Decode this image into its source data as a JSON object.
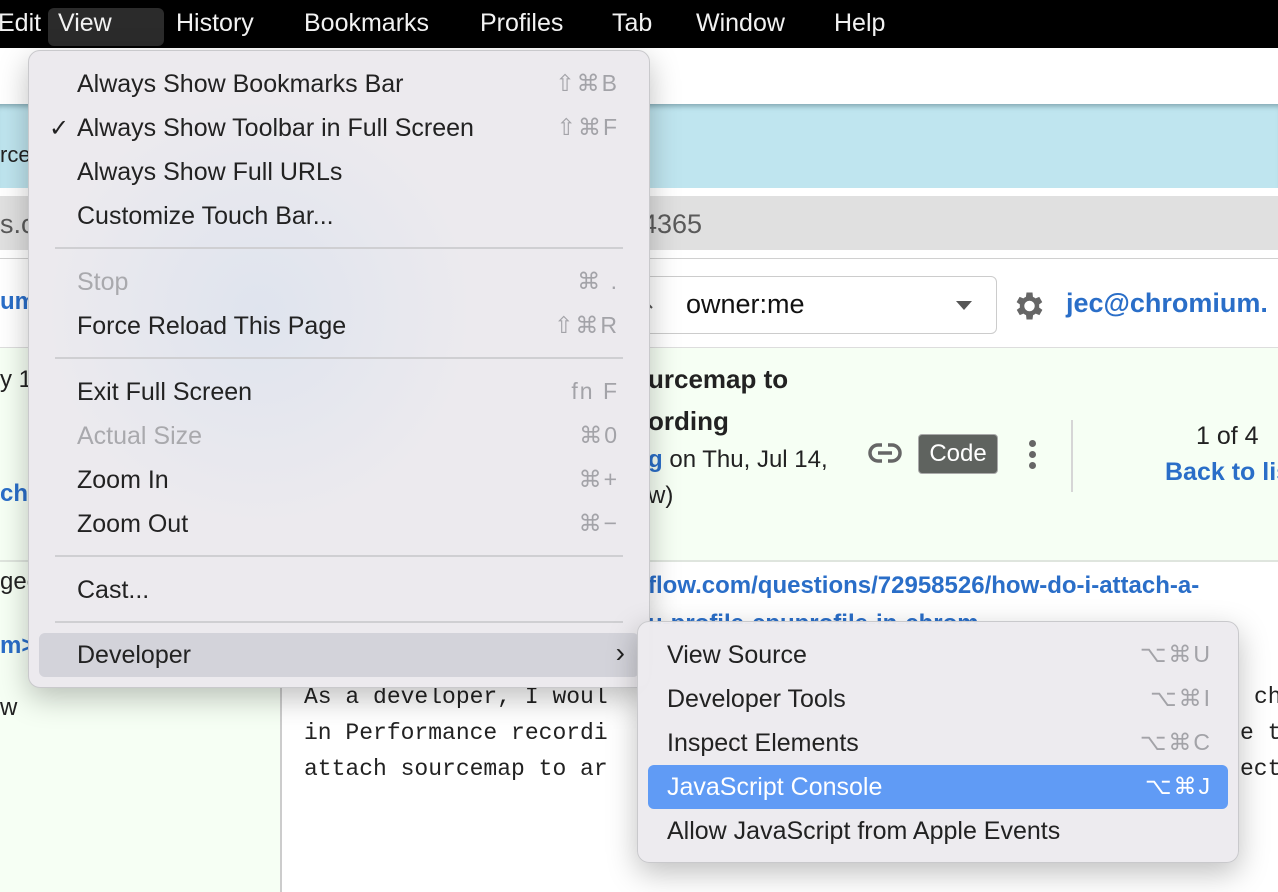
{
  "menubar": {
    "items": [
      "Edit",
      "View",
      "History",
      "Bookmarks",
      "Profiles",
      "Tab",
      "Window",
      "Help"
    ],
    "active": "View"
  },
  "page": {
    "blue_band_left_fragment": "rce",
    "address_left_fragment": "s.c",
    "address_right_fragment": "4365",
    "search_value": "owner:me",
    "user_email": "jec@chromium.",
    "left_fragments": {
      "um": "um",
      "y1": "y 1",
      "chr": "chr",
      "ged": "ged",
      "m": "m>",
      "w": "w"
    },
    "issue_title_line1": "urcemap to",
    "issue_title_line2": "ording",
    "meta_link_fragment": "g",
    "meta_text": " on Thu, Jul 14,",
    "meta_line2": "w)",
    "code_button": "Code",
    "pager": "1 of 4",
    "back_link": "Back to lis",
    "url_line1": "flow.com/questions/72958526/how-do-i-attach-a-",
    "url_line2": "u-profile-cpuprofile-in-chrom",
    "body_lines": [
      "As a developer, I woul",
      "in Performance recordi",
      "attach sourcemap to ar"
    ],
    "body_right_fragments": [
      "ch",
      "e t",
      "ect"
    ]
  },
  "view_menu": {
    "items": [
      {
        "label": "Always Show Bookmarks Bar",
        "shortcut": "⇧⌘B",
        "checked": false,
        "enabled": true
      },
      {
        "label": "Always Show Toolbar in Full Screen",
        "shortcut": "⇧⌘F",
        "checked": true,
        "enabled": true
      },
      {
        "label": "Always Show Full URLs",
        "shortcut": "",
        "checked": false,
        "enabled": true
      },
      {
        "label": "Customize Touch Bar...",
        "shortcut": "",
        "checked": false,
        "enabled": true
      },
      {
        "label": "Stop",
        "shortcut": "⌘ .",
        "checked": false,
        "enabled": false
      },
      {
        "label": "Force Reload This Page",
        "shortcut": "⇧⌘R",
        "checked": false,
        "enabled": true
      },
      {
        "label": "Exit Full Screen",
        "shortcut": "fn F",
        "checked": false,
        "enabled": true
      },
      {
        "label": "Actual Size",
        "shortcut": "⌘0",
        "checked": false,
        "enabled": false
      },
      {
        "label": "Zoom In",
        "shortcut": "⌘+",
        "checked": false,
        "enabled": true
      },
      {
        "label": "Zoom Out",
        "shortcut": "⌘−",
        "checked": false,
        "enabled": true
      },
      {
        "label": "Cast...",
        "shortcut": "",
        "checked": false,
        "enabled": true
      },
      {
        "label": "Developer",
        "shortcut": "",
        "checked": false,
        "enabled": true,
        "submenu": true
      }
    ],
    "check_glyph": "✓",
    "submenu_glyph": "›"
  },
  "developer_menu": {
    "items": [
      {
        "label": "View Source",
        "shortcut": "⌥⌘U"
      },
      {
        "label": "Developer Tools",
        "shortcut": "⌥⌘I"
      },
      {
        "label": "Inspect Elements",
        "shortcut": "⌥⌘C"
      },
      {
        "label": "JavaScript Console",
        "shortcut": "⌥⌘J",
        "selected": true
      },
      {
        "label": "Allow JavaScript from Apple Events",
        "shortcut": ""
      }
    ]
  },
  "colors": {
    "menu_selection": "#609bf5",
    "link": "#2a6ec8",
    "blue_band": "#bfe5ef"
  }
}
